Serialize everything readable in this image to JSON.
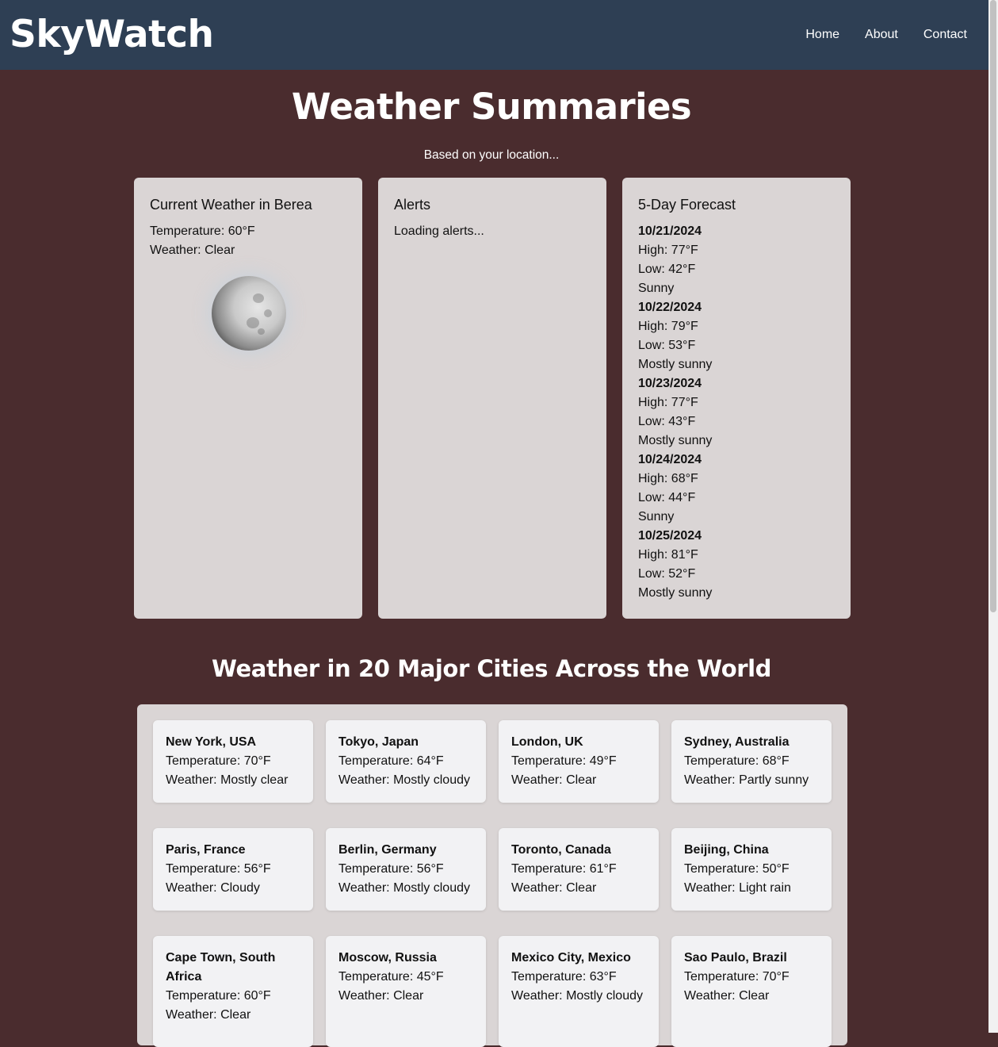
{
  "header": {
    "brand": "SkyWatch",
    "nav": [
      {
        "label": "Home"
      },
      {
        "label": "About"
      },
      {
        "label": "Contact"
      }
    ]
  },
  "main": {
    "title": "Weather Summaries",
    "subtitle": "Based on your location...",
    "current": {
      "title": "Current Weather in Berea",
      "temperature": "Temperature: 60°F",
      "weather": "Weather: Clear",
      "icon": "moon-icon"
    },
    "alerts": {
      "title": "Alerts",
      "status": "Loading alerts..."
    },
    "forecast": {
      "title": "5-Day Forecast",
      "days": [
        {
          "date": "10/21/2024",
          "high": "High: 77°F",
          "low": "Low: 42°F",
          "condition": "Sunny"
        },
        {
          "date": "10/22/2024",
          "high": "High: 79°F",
          "low": "Low: 53°F",
          "condition": "Mostly sunny"
        },
        {
          "date": "10/23/2024",
          "high": "High: 77°F",
          "low": "Low: 43°F",
          "condition": "Mostly sunny"
        },
        {
          "date": "10/24/2024",
          "high": "High: 68°F",
          "low": "Low: 44°F",
          "condition": "Sunny"
        },
        {
          "date": "10/25/2024",
          "high": "High: 81°F",
          "low": "Low: 52°F",
          "condition": "Mostly sunny"
        }
      ]
    }
  },
  "cities": {
    "title": "Weather in 20 Major Cities Across the World",
    "items": [
      {
        "name": "New York, USA",
        "temperature": "Temperature: 70°F",
        "weather": "Weather: Mostly clear"
      },
      {
        "name": "Tokyo, Japan",
        "temperature": "Temperature: 64°F",
        "weather": "Weather: Mostly cloudy"
      },
      {
        "name": "London, UK",
        "temperature": "Temperature: 49°F",
        "weather": "Weather: Clear"
      },
      {
        "name": "Sydney, Australia",
        "temperature": "Temperature: 68°F",
        "weather": "Weather: Partly sunny"
      },
      {
        "name": "Paris, France",
        "temperature": "Temperature: 56°F",
        "weather": "Weather: Cloudy"
      },
      {
        "name": "Berlin, Germany",
        "temperature": "Temperature: 56°F",
        "weather": "Weather: Mostly cloudy"
      },
      {
        "name": "Toronto, Canada",
        "temperature": "Temperature: 61°F",
        "weather": "Weather: Clear"
      },
      {
        "name": "Beijing, China",
        "temperature": "Temperature: 50°F",
        "weather": "Weather: Light rain"
      },
      {
        "name": "Cape Town, South Africa",
        "temperature": "Temperature: 60°F",
        "weather": "Weather: Clear"
      },
      {
        "name": "Moscow, Russia",
        "temperature": "Temperature: 45°F",
        "weather": "Weather: Clear"
      },
      {
        "name": "Mexico City, Mexico",
        "temperature": "Temperature: 63°F",
        "weather": "Weather: Mostly cloudy"
      },
      {
        "name": "Sao Paulo, Brazil",
        "temperature": "Temperature: 70°F",
        "weather": "Weather: Clear"
      }
    ]
  }
}
